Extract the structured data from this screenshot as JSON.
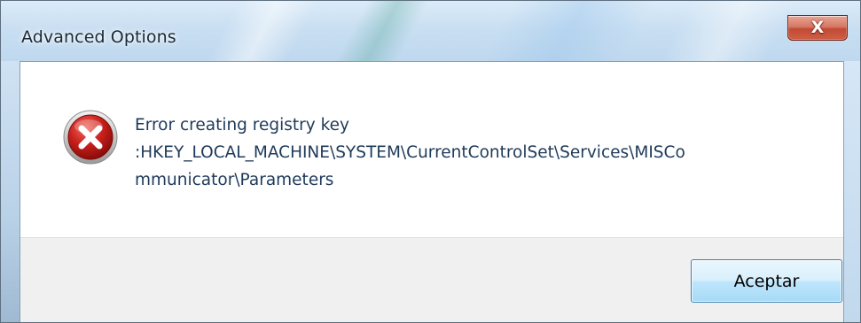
{
  "window": {
    "title": "Advanced Options",
    "close_glyph": "X"
  },
  "dialog": {
    "icon": "error-icon",
    "message_lines": [
      "Error creating registry key",
      ":HKEY_LOCAL_MACHINE\\SYSTEM\\CurrentControlSet\\Services\\MISCo",
      "mmunicator\\Parameters"
    ],
    "ok_label": "Aceptar"
  },
  "colors": {
    "error_red": "#c8201c",
    "message_text": "#1e3a5a",
    "button_border": "#3c7fb1",
    "footer_bg": "#f0f0f0"
  }
}
